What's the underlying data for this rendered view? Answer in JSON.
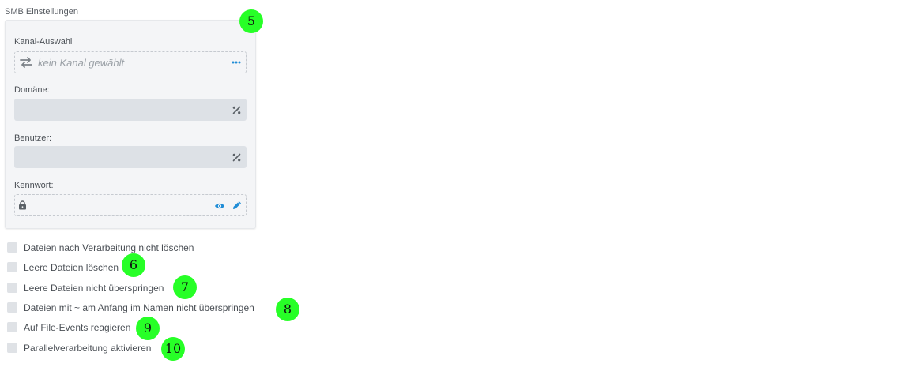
{
  "section": {
    "title": "SMB Einstellungen"
  },
  "fields": {
    "channel": {
      "label": "Kanal-Auswahl",
      "placeholder": "kein Kanal gewählt"
    },
    "domain": {
      "label": "Domäne:",
      "value": ""
    },
    "user": {
      "label": "Benutzer:",
      "value": ""
    },
    "password": {
      "label": "Kennwort:",
      "value": ""
    }
  },
  "options": [
    {
      "label": "Dateien nach Verarbeitung nicht löschen",
      "checked": false
    },
    {
      "label": "Leere Dateien löschen",
      "checked": false
    },
    {
      "label": "Leere Dateien nicht überspringen",
      "checked": false
    },
    {
      "label": "Dateien mit ~ am Anfang im Namen nicht überspringen",
      "checked": false
    },
    {
      "label": "Auf File-Events reagieren",
      "checked": false
    },
    {
      "label": "Parallelverarbeitung aktivieren",
      "checked": false
    }
  ],
  "annotations": [
    "5",
    "6",
    "7",
    "8",
    "9",
    "10"
  ],
  "icons": {
    "channel": "swap-arrows-icon",
    "channel_more": "more-dots-icon",
    "variable": "percent-icon",
    "lock": "lock-icon",
    "show": "eye-icon",
    "edit": "pencil-icon"
  },
  "colors": {
    "accent": "#1f8dd6",
    "badge": "#27ff27"
  }
}
